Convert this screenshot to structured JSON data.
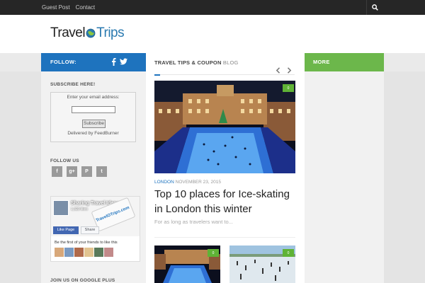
{
  "topbar": {
    "nav": [
      "Guest Post",
      "Contact"
    ],
    "search_icon": "search-icon"
  },
  "logo": {
    "part1": "Travel",
    "part2": "Trips"
  },
  "left": {
    "follow_label": "FOLLOW:",
    "follow_icons": [
      "facebook-icon",
      "twitter-icon"
    ],
    "subscribe": {
      "title": "SUBSCRIBE HERE!",
      "prompt": "Enter your email address:",
      "button": "Subscribe",
      "delivered": "Delivered by FeedBurner"
    },
    "follow_us_title": "FOLLOW US",
    "social_icons": [
      "facebook-icon",
      "google-plus-icon",
      "pinterest-icon",
      "twitter-icon"
    ],
    "fb": {
      "page_name": "Sharing Travel Ideas",
      "likes": "1,323 likes",
      "tag_text": "TravelOTrips.com",
      "like_btn": "Like Page",
      "share_btn": "Share",
      "first": "Be the first of your friends to like this"
    },
    "gplus_title": "JOIN US ON GOOGLE PLUS"
  },
  "main": {
    "heading": "TRAVEL TIPS & COUPON",
    "heading_suffix": "BLOG",
    "post": {
      "category": "LONDON",
      "date": "NOVEMBER 23, 2015",
      "title": "Top 10 places for Ice-skating in London this winter",
      "excerpt": "For as long as travelers want to...",
      "comments": "0"
    },
    "thumbs": [
      {
        "comments": "0"
      },
      {
        "comments": "0"
      }
    ]
  },
  "right": {
    "more_label": "MORE"
  },
  "colors": {
    "blue": "#1e73be",
    "green": "#6cb74b",
    "dark": "#262626"
  }
}
